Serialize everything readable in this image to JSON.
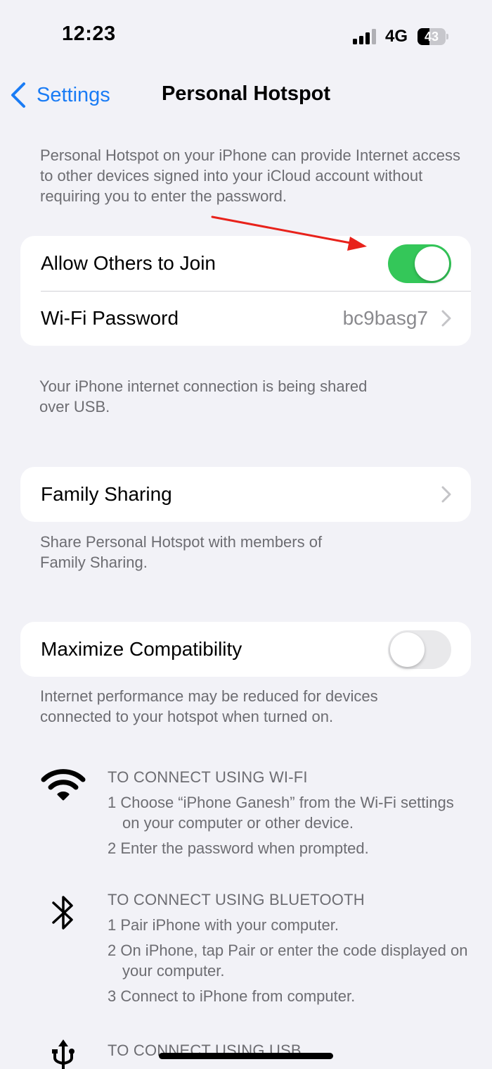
{
  "status_bar": {
    "time": "12:23",
    "network": "4G",
    "battery": "43",
    "battery_level": 0.43
  },
  "nav": {
    "back_label": "Settings",
    "title": "Personal Hotspot"
  },
  "intro_text": "Personal Hotspot on your iPhone can provide Internet access to other devices signed into your iCloud account without requiring you to enter the password.",
  "group1": {
    "allow_others": {
      "label": "Allow Others to Join",
      "on": true
    },
    "wifi_password": {
      "label": "Wi-Fi Password",
      "value": "bc9basg7"
    },
    "footer_line1": "Your iPhone internet connection is being shared",
    "footer_line2": "over USB."
  },
  "group2": {
    "family_sharing": {
      "label": "Family Sharing"
    },
    "footer_line1": "Share Personal Hotspot with members of",
    "footer_line2": "Family Sharing."
  },
  "group3": {
    "maximize": {
      "label": "Maximize Compatibility",
      "on": false
    },
    "footer_line1": "Internet performance may be reduced for devices",
    "footer_line2": "connected to your hotspot when turned on."
  },
  "instructions": {
    "wifi": {
      "icon": "wifi-icon",
      "heading": "TO CONNECT USING WI-FI",
      "steps": [
        "1 Choose “iPhone Ganesh” from the Wi-Fi settings on your computer or other device.",
        "2 Enter the password when prompted."
      ]
    },
    "bluetooth": {
      "icon": "bluetooth-icon",
      "heading": "TO CONNECT USING BLUETOOTH",
      "steps": [
        "1 Pair iPhone with your computer.",
        "2 On iPhone, tap Pair or enter the code displayed on your computer.",
        "3 Connect to iPhone from computer."
      ]
    },
    "usb": {
      "icon": "usb-icon",
      "heading": "TO CONNECT USING USB"
    }
  },
  "colors": {
    "accent": "#1a7cf5",
    "toggle_on": "#34c759",
    "background": "#f2f2f7",
    "annotation_arrow": "#e8221b"
  }
}
